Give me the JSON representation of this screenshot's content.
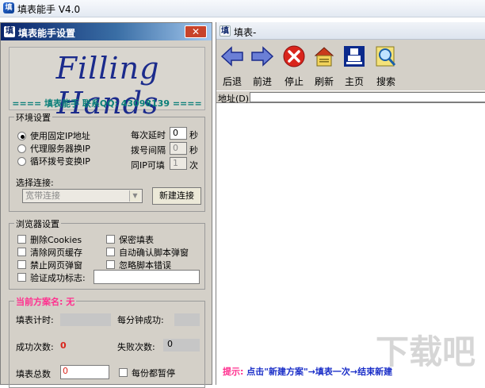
{
  "app": {
    "title": "填表能手 V4.0",
    "logo_glyph": "填"
  },
  "settings": {
    "title": "填表能手设置",
    "close_glyph": "✕",
    "logo_text": "Filling Hands",
    "contact": "==== 填表能手 联系QQ: 43098139 ===="
  },
  "env": {
    "legend": "环境设置",
    "radios": [
      "使用固定IP地址",
      "代理服务器换IP",
      "循环拨号变换IP"
    ],
    "radio_selected": 0,
    "delay_label": "每次延时",
    "delay_value": "0",
    "delay_unit": "秒",
    "dial_label": "拨号间隔",
    "dial_value": "0",
    "dial_unit": "秒",
    "sameip_label": "同IP可填",
    "sameip_value": "1",
    "sameip_unit": "次",
    "conn_label": "选择连接:",
    "conn_value": "宽带连接",
    "new_conn_button": "新建连接"
  },
  "browser_settings": {
    "legend": "浏览器设置",
    "checkboxes": [
      "删除Cookies",
      "保密填表",
      "清除网页缓存",
      "自动确认脚本弹窗",
      "禁止网页弹窗",
      "忽略脚本错误"
    ],
    "verify_label": "验证成功标志:"
  },
  "plan": {
    "legend": "当前方案名: 无",
    "timer_label": "填表计时:",
    "per_min_label": "每分钟成功:",
    "success_label": "成功次数:",
    "success_value": "0",
    "fail_label": "失败次数:",
    "fail_value": "0",
    "total_label": "填表总数",
    "total_value": "0",
    "pause_label": "每份都暂停"
  },
  "browser": {
    "title": "填表-",
    "tools": [
      {
        "label": "后退",
        "icon": "back-arrow-icon"
      },
      {
        "label": "前进",
        "icon": "forward-arrow-icon"
      },
      {
        "label": "停止",
        "icon": "stop-icon"
      },
      {
        "label": "刷新",
        "icon": "refresh-icon"
      },
      {
        "label": "主页",
        "icon": "home-icon"
      },
      {
        "label": "搜索",
        "icon": "search-icon"
      }
    ],
    "address_label": "地址(D)",
    "address_value": "",
    "hint_label": "提示:",
    "hint_text": "点击\"新建方案\"→填表一次→结束新建"
  },
  "watermark": "下载吧",
  "colors": {
    "title_dark": "#0a246a",
    "accent_blue": "#1a2ec8",
    "accent_pink": "#ff2f8e",
    "logo_teal": "#0a7f79",
    "stop_red": "#d9251c"
  }
}
